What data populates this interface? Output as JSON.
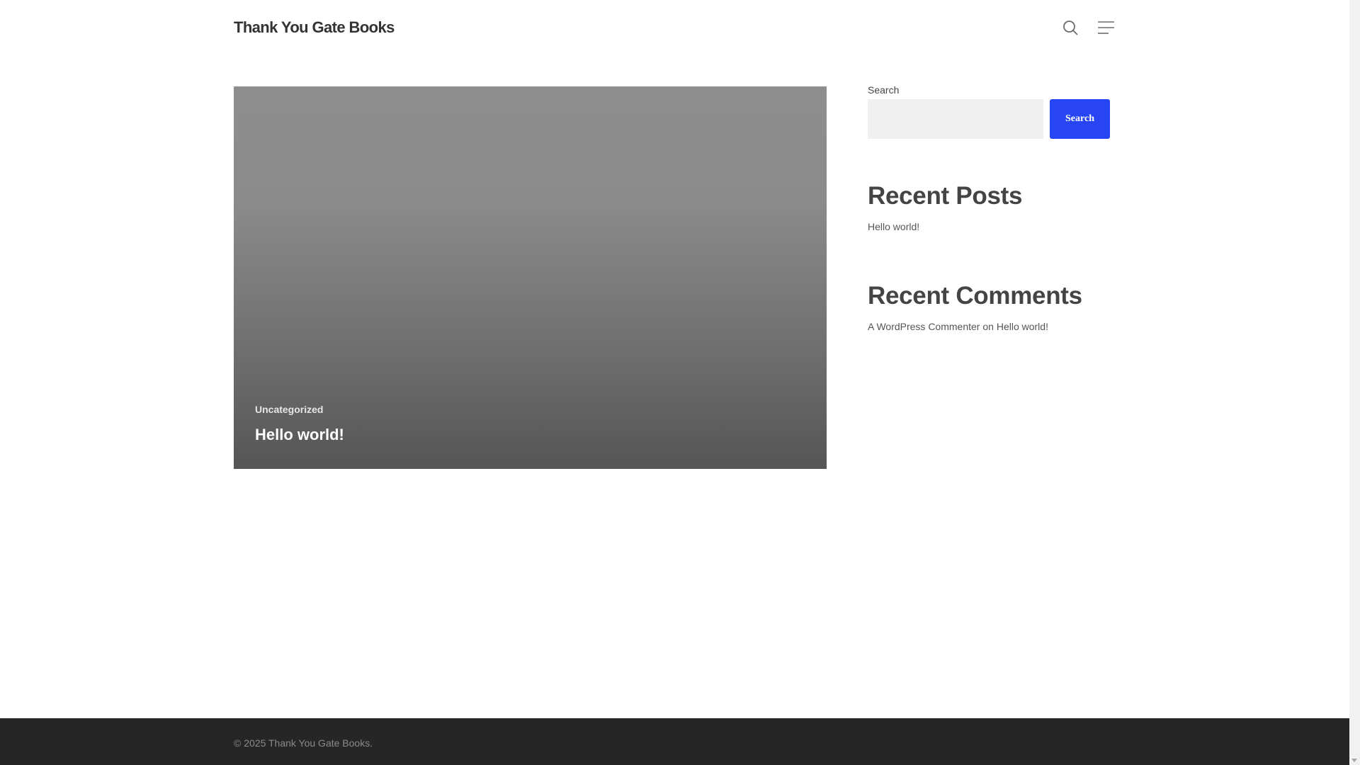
{
  "header": {
    "site_title": "Thank You Gate Books",
    "search_icon": "search-icon",
    "menu_icon": "menu-icon"
  },
  "main": {
    "post": {
      "category": "Uncategorized",
      "title": "Hello world!"
    }
  },
  "sidebar": {
    "search": {
      "label": "Search",
      "input_value": "",
      "button_label": "Search"
    },
    "recent_posts": {
      "heading": "Recent Posts",
      "items": [
        "Hello world!"
      ]
    },
    "recent_comments": {
      "heading": "Recent Comments",
      "items": [
        {
          "author": "A WordPress Commenter",
          "connector": "on",
          "post": "Hello world!"
        }
      ]
    }
  },
  "footer": {
    "text": "© 2025 Thank You Gate Books."
  },
  "colors": {
    "accent": "#2745f2",
    "footer_bg": "#262626"
  }
}
